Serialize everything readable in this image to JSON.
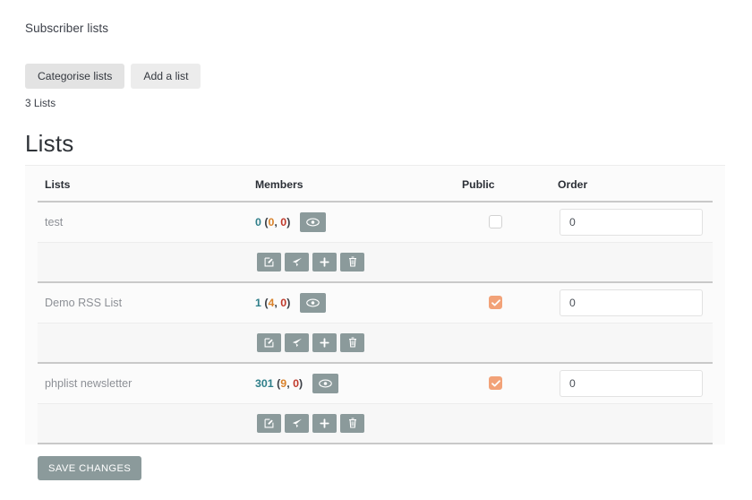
{
  "breadcrumb": "Subscriber lists",
  "toolbar": {
    "categorise_label": "Categorise lists",
    "add_list_label": "Add a list"
  },
  "list_count_text": "3 Lists",
  "page_title": "Lists",
  "table": {
    "headers": {
      "lists": "Lists",
      "members": "Members",
      "public": "Public",
      "order": "Order"
    },
    "rows": [
      {
        "name": "test",
        "members_total": "0",
        "members_open": "(",
        "members_unconfirmed": "0",
        "members_sep": ", ",
        "members_blacklisted": "0",
        "members_close": ")",
        "public": false,
        "order_value": "0"
      },
      {
        "name": "Demo RSS List",
        "members_total": "1",
        "members_open": "(",
        "members_unconfirmed": "4",
        "members_sep": ", ",
        "members_blacklisted": "0",
        "members_close": ")",
        "public": true,
        "order_value": "0"
      },
      {
        "name": "phplist newsletter",
        "members_total": "301",
        "members_open": "(",
        "members_unconfirmed": "9",
        "members_sep": ", ",
        "members_blacklisted": "0",
        "members_close": ")",
        "public": true,
        "order_value": "0"
      }
    ],
    "row_actions": {
      "edit": "edit-icon",
      "send": "send-campaign-icon",
      "add": "add-subscriber-icon",
      "delete": "delete-icon"
    },
    "preview_icon": "eye-icon"
  },
  "save_label": "SAVE CHANGES",
  "colors": {
    "members_total": "#2f7f8a",
    "members_unconfirmed": "#d9822b",
    "members_blacklisted": "#c0392b",
    "checkbox_checked": "#f2a278",
    "button_primary": "#8b9a9b",
    "toolbar_button": "#e3e3e3"
  }
}
